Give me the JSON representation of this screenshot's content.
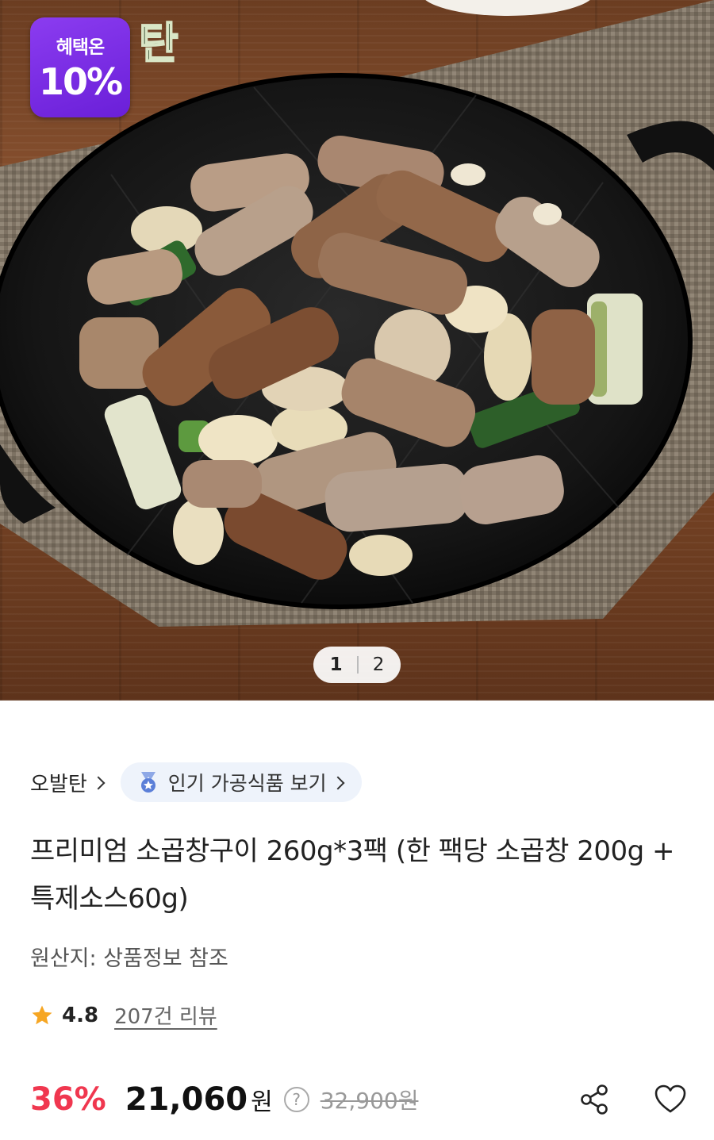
{
  "hero": {
    "badge_top": "혜택온",
    "badge_pct": "10%",
    "brand_mark": "탄",
    "pager_current": "1",
    "pager_total": "2"
  },
  "breadcrumb": {
    "brand": "오발탄",
    "category_pill": "인기 가공식품 보기"
  },
  "product": {
    "title": "프리미엄 소곱창구이 260g*3팩 (한 팩당 소곱창 200g + 특제소스60g)",
    "origin": "원산지: 상품정보 참조",
    "rating": "4.8",
    "reviews": "207건 리뷰"
  },
  "price": {
    "discount": "36%",
    "sale": "21,060",
    "currency": "원",
    "help": "?",
    "original": "32,900원"
  },
  "icons": {
    "share": "share-icon",
    "heart": "heart-icon",
    "star": "star-icon",
    "medal": "medal-icon"
  },
  "colors": {
    "discount": "#f0374f",
    "badge": "#7a2de4",
    "star": "#f6a623",
    "pill_bg": "#eef3fb"
  }
}
